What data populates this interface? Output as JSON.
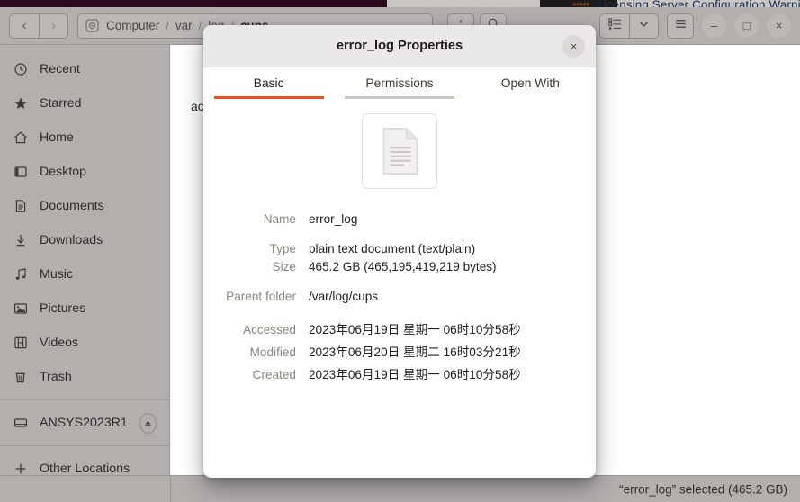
{
  "background_window": {
    "title": "Licensing Server Configuration Warnings and",
    "dots": "*****"
  },
  "window": {
    "nav": {
      "back": "‹",
      "forward": "›"
    },
    "pathbar": {
      "icon": "computer-disc-icon",
      "crumbs": [
        {
          "label": "Computer",
          "current": false
        },
        {
          "label": "var",
          "current": false
        },
        {
          "label": "log",
          "current": false
        },
        {
          "label": "cups",
          "current": true
        }
      ],
      "separator": "/"
    },
    "header_buttons": {
      "menu_dots": "⋮",
      "search": "search-icon",
      "view_list": "list-view-icon",
      "view_dropdown": "⌄",
      "hamburger": "☰",
      "minimize": "–",
      "maximize": "□",
      "close": "×"
    }
  },
  "sidebar": {
    "items": [
      {
        "label": "Recent",
        "icon": "clock-icon"
      },
      {
        "label": "Starred",
        "icon": "star-icon"
      },
      {
        "label": "Home",
        "icon": "home-icon"
      },
      {
        "label": "Desktop",
        "icon": "desktop-icon"
      },
      {
        "label": "Documents",
        "icon": "document-icon"
      },
      {
        "label": "Downloads",
        "icon": "download-icon"
      },
      {
        "label": "Music",
        "icon": "music-note-icon"
      },
      {
        "label": "Pictures",
        "icon": "picture-icon"
      },
      {
        "label": "Videos",
        "icon": "film-icon"
      },
      {
        "label": "Trash",
        "icon": "trash-icon"
      }
    ],
    "devices": [
      {
        "label": "ANSYS2023R1",
        "icon": "drive-icon",
        "eject": "⏏"
      }
    ],
    "other": {
      "label": "Other Locations",
      "icon": "plus-icon"
    }
  },
  "file_list": {
    "visible_entry": "ac"
  },
  "statusbar": {
    "text": "“error_log” selected  (465.2 GB)"
  },
  "dialog": {
    "title": "error_log Properties",
    "close": "×",
    "tabs": [
      {
        "label": "Basic",
        "state": "active"
      },
      {
        "label": "Permissions",
        "state": "sub"
      },
      {
        "label": "Open With",
        "state": "none"
      }
    ],
    "file_icon": "text-document-icon",
    "properties": [
      {
        "key": "Name",
        "value": "error_log",
        "spaced": false
      },
      {
        "key": "Type",
        "value": "plain text document (text/plain)",
        "spaced": true
      },
      {
        "key": "Size",
        "value": "465.2 GB (465,195,419,219 bytes)",
        "spaced": false
      },
      {
        "key": "Parent folder",
        "value": "/var/log/cups",
        "spaced": true
      },
      {
        "key": "Accessed",
        "value": "2023年06月19日 星期一 06时10分58秒",
        "spaced": true
      },
      {
        "key": "Modified",
        "value": "2023年06月20日 星期二 16时03分21秒",
        "spaced": false
      },
      {
        "key": "Created",
        "value": "2023年06月19日 星期一 06时10分58秒",
        "spaced": false
      }
    ]
  },
  "colors": {
    "accent": "#e8521f",
    "headerbar": "#b2afad",
    "sidebar": "#b2afad",
    "dialog_head": "#ebe9e7",
    "bg_title_text": "#1c2f52"
  }
}
